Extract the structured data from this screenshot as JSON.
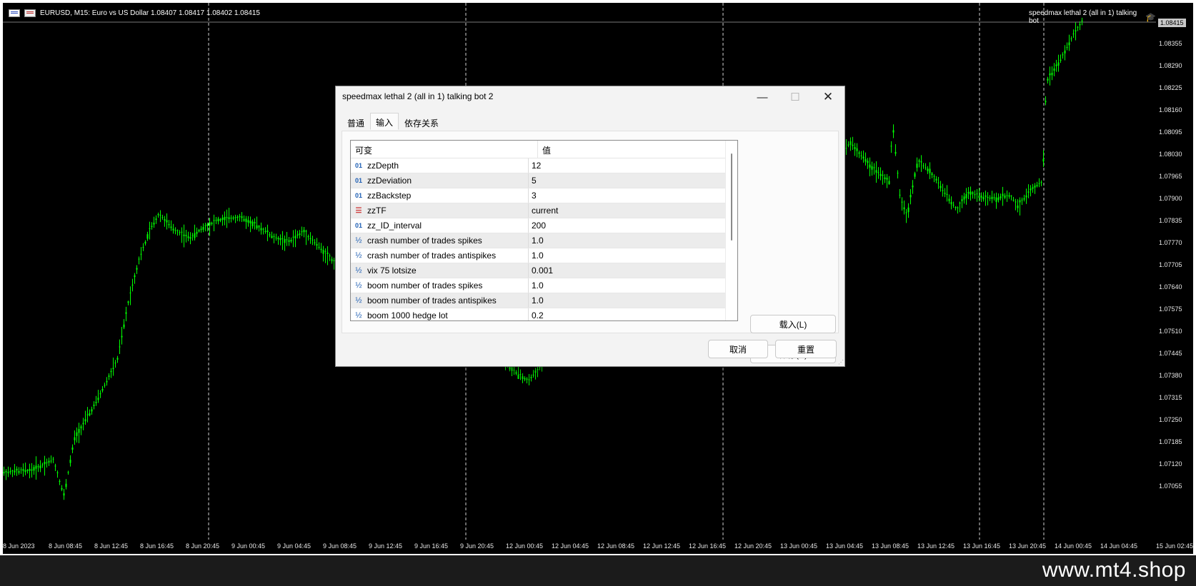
{
  "chart": {
    "symbol_line": "EURUSD, M15:  Euro vs US Dollar  1.08407 1.08417 1.08402 1.08415",
    "ea_name": "speedmax lethal 2 (all in 1)  talking bot",
    "current_price": "1.08415",
    "price_labels": [
      "1.08355",
      "1.08290",
      "1.08225",
      "1.08160",
      "1.08095",
      "1.08030",
      "1.07965",
      "1.07900",
      "1.07835",
      "1.07770",
      "1.07705",
      "1.07640",
      "1.07575",
      "1.07510",
      "1.07445",
      "1.07380",
      "1.07315",
      "1.07250",
      "1.07185",
      "1.07120",
      "1.07055"
    ],
    "time_labels": [
      "8 Jun 2023",
      "8 Jun 08:45",
      "8 Jun 12:45",
      "8 Jun 16:45",
      "8 Jun 20:45",
      "9 Jun 00:45",
      "9 Jun 04:45",
      "9 Jun 08:45",
      "9 Jun 12:45",
      "9 Jun 16:45",
      "9 Jun 20:45",
      "12 Jun 00:45",
      "12 Jun 04:45",
      "12 Jun 08:45",
      "12 Jun 12:45",
      "12 Jun 16:45",
      "12 Jun 20:45",
      "13 Jun 00:45",
      "13 Jun 04:45",
      "13 Jun 08:45",
      "13 Jun 12:45",
      "13 Jun 16:45",
      "13 Jun 20:45",
      "14 Jun 00:45",
      "14 Jun 04:45",
      "15 Jun 02:45"
    ],
    "candle_color": "#00ff00",
    "background": "#000000"
  },
  "dialog": {
    "title": "speedmax lethal 2 (all in 1)  talking bot 2",
    "tabs": [
      {
        "label": "普通",
        "active": false
      },
      {
        "label": "输入",
        "active": true
      },
      {
        "label": "依存关系",
        "active": false
      }
    ],
    "grid": {
      "col_variable": "可变",
      "col_value": "值",
      "rows": [
        {
          "icon": "01",
          "name": "zzDepth",
          "value": "12"
        },
        {
          "icon": "01",
          "name": "zzDeviation",
          "value": "5"
        },
        {
          "icon": "01",
          "name": "zzBackstep",
          "value": "3"
        },
        {
          "icon": "enum",
          "name": "zzTF",
          "value": "current"
        },
        {
          "icon": "01",
          "name": "zz_ID_interval",
          "value": "200"
        },
        {
          "icon": "½",
          "name": "crash number of trades spikes",
          "value": "1.0"
        },
        {
          "icon": "½",
          "name": "crash number of trades antispikes",
          "value": "1.0"
        },
        {
          "icon": "½",
          "name": "vix 75 lotsize",
          "value": "0.001"
        },
        {
          "icon": "½",
          "name": "boom number of trades spikes",
          "value": "1.0"
        },
        {
          "icon": "½",
          "name": "boom number of trades antispikes",
          "value": "1.0"
        },
        {
          "icon": "½",
          "name": "boom 1000 hedge lot",
          "value": "0.2"
        }
      ]
    },
    "buttons": {
      "load": "载入(L)",
      "save": "保存(S)",
      "cancel": "取消",
      "reset": "重置"
    }
  },
  "watermark": "www.mt4.shop"
}
